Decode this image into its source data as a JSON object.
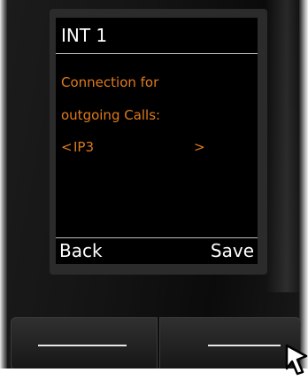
{
  "display": {
    "title": "INT 1",
    "message_line_1": "Connection for",
    "message_line_2": "outgoing Calls:",
    "selector": {
      "prev_arrow": "<",
      "value": "IP3",
      "next_arrow": ">"
    },
    "softkeys": {
      "left": "Back",
      "right": "Save"
    }
  },
  "colors": {
    "screen_background": "#000000",
    "title_text": "#ffffff",
    "message_text": "#e07a1c",
    "softkey_text": "#ffffff",
    "separator": "#bfbfbf"
  },
  "icons": {
    "pointer": "arrow-pointer-icon"
  }
}
